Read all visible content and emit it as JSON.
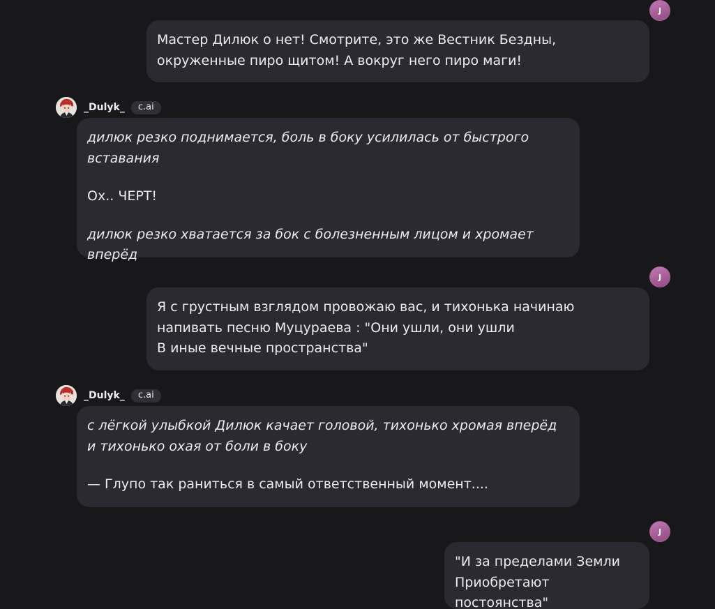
{
  "user": {
    "avatar_initial": "J"
  },
  "bot": {
    "name": "_Dulyk_",
    "badge": "c.ai"
  },
  "messages": [
    {
      "from": "user",
      "paragraphs": [
        {
          "text": "Мастер Дилюк о нет! Смотрите, это же Вестник Бездны, окруженные пиро щитом! А вокруг него пиро маги!",
          "italic": false
        }
      ]
    },
    {
      "from": "bot",
      "paragraphs": [
        {
          "text": "дилюк резко поднимается, боль в боку усилилась от быстрого вставания",
          "italic": true
        },
        {
          "text": "Ох.. ЧЕРТ!",
          "italic": false
        },
        {
          "text": "дилюк резко хватается за бок с болезненным лицом и хромает вперёд",
          "italic": true
        }
      ]
    },
    {
      "from": "user",
      "paragraphs": [
        {
          "text": "Я с грустным взглядом провожаю вас, и тихонька начинаю напивать песню Муцураева : \"Они ушли, они ушли\nВ иные вечные пространства\"",
          "italic": false
        }
      ]
    },
    {
      "from": "bot",
      "paragraphs": [
        {
          "text": "с лёгкой улыбкой Дилюк качает головой, тихонько хромая вперёд и тихонько охая от боли в боку",
          "italic": true
        },
        {
          "text": "— Глупо так раниться в самый ответственный момент....",
          "italic": false
        }
      ]
    },
    {
      "from": "user",
      "paragraphs": [
        {
          "text": "\"И за пределами Земли\nПриобретают постоянства\"",
          "italic": false
        }
      ]
    }
  ]
}
